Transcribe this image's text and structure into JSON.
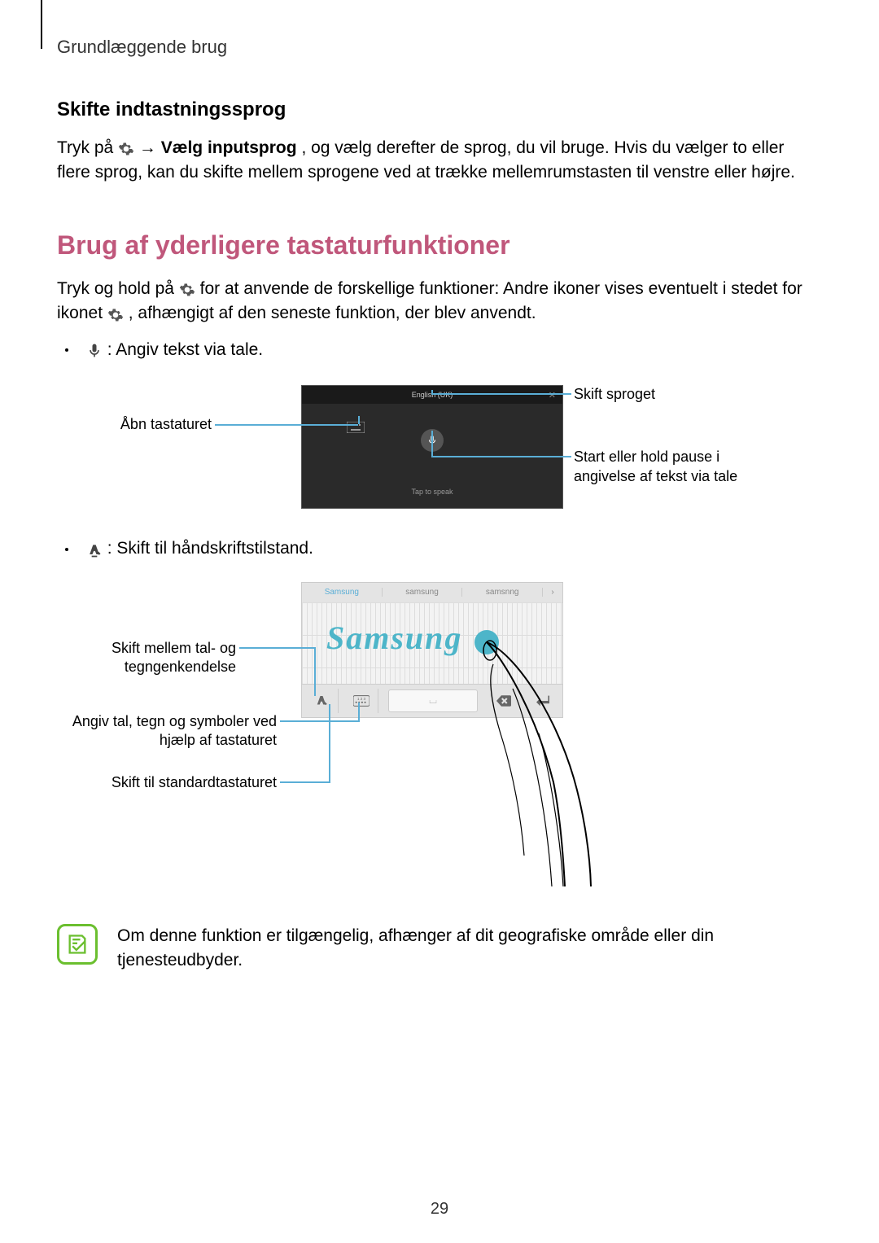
{
  "header": "Grundlæggende brug",
  "sec1": {
    "title": "Skifte indtastningssprog",
    "p1a": "Tryk på ",
    "p1b": " → ",
    "p1bold": "Vælg inputsprog",
    "p1c": ", og vælg derefter de sprog, du vil bruge. Hvis du vælger to eller flere sprog, kan du skifte mellem sprogene ved at trække mellemrumstasten til venstre eller højre."
  },
  "sec2": {
    "title": "Brug af yderligere tastaturfunktioner",
    "p1a": "Tryk og hold på ",
    "p1b": " for at anvende de forskellige funktioner: Andre ikoner vises eventuelt i stedet for ikonet ",
    "p1c": ", afhængigt af den seneste funktion, der blev anvendt.",
    "bullet1": " : Angiv tekst via tale.",
    "bullet2": " : Skift til håndskriftstilstand."
  },
  "dia1": {
    "lang": "English (UK)",
    "open_kb": "Åbn tastaturet",
    "change_lang": "Skift sproget",
    "start_pause": "Start eller hold pause i angivelse af tekst via tale",
    "tap": "Tap to speak"
  },
  "dia2": {
    "sug1": "Samsung",
    "sug2": "samsung",
    "sug3": "samsnng",
    "handwriting": "Samsung",
    "switch_num": "Skift mellem tal- og tegngenkendelse",
    "enter_sym": "Angiv tal, tegn og symboler ved hjælp af tastaturet",
    "switch_std": "Skift til standardtastaturet"
  },
  "note": "Om denne funktion er tilgængelig, afhænger af dit geografiske område eller din tjenesteudbyder.",
  "page_num": "29"
}
